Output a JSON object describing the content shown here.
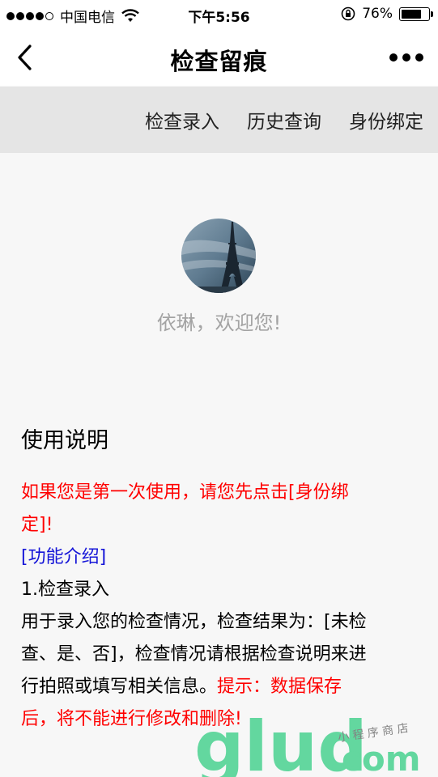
{
  "status_bar": {
    "carrier": "中国电信",
    "time": "下午5:56",
    "battery": "76%",
    "battery_level": 0.76
  },
  "nav": {
    "title": "检查留痕",
    "back_icon": "chevron-left-icon",
    "more_icon": "more-dots-icon"
  },
  "tabs": [
    {
      "label": "检查录入"
    },
    {
      "label": "历史查询"
    },
    {
      "label": "身份绑定"
    }
  ],
  "profile": {
    "welcome": "依琳，欢迎您!"
  },
  "instructions": {
    "title": "使用说明",
    "first_use_line1": "如果您是第一次使用，请您先点击[身份绑",
    "first_use_line2": "定]!",
    "intro_label": "[功能介绍]",
    "item1_title": "1.检查录入",
    "item1_line1": "用于录入您的检查情况，检查结果为：[未检",
    "item1_line2": "查、是、否]，检查情况请根据检查说明来进",
    "item1_line3": "行拍照或填写相关信息。",
    "tip_inline": "提示：数据保存",
    "item1_line4": "后，将不能进行修改和删除!"
  },
  "colors": {
    "warning": "#ff0000",
    "link": "#1515d8",
    "tab_bar": "#e5e5e5",
    "welcome_text": "#a3a3a3"
  }
}
